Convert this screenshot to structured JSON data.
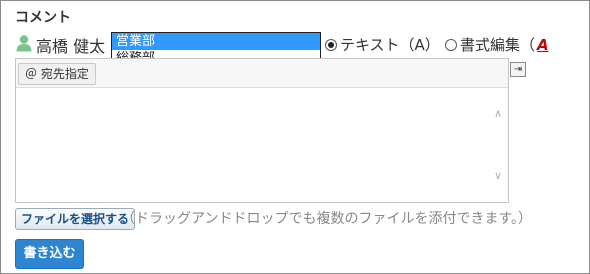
{
  "section_title": "コメント",
  "user": {
    "name": "高橋 健太",
    "icon": "user-icon"
  },
  "department_dropdown": {
    "options": [
      "営業部",
      "総務部"
    ],
    "selected": "営業部"
  },
  "format_options": [
    {
      "label": "テキスト（A）",
      "checked": true
    },
    {
      "label": "書式編集（",
      "checked": false,
      "icon_text": "A"
    }
  ],
  "editor": {
    "mention_button": "＠ 宛先指定",
    "scroll_up": "∧",
    "scroll_down": "∨",
    "expand_icon": "expand-icon"
  },
  "attachments": {
    "button_label": "ファイルを選択する",
    "hint": "（ドラッグアンドドロップでも複数のファイルを添付できます。）"
  },
  "submit_label": "書き込む",
  "colors": {
    "accent": "#2e86d2",
    "selection": "#3399ff",
    "user_icon": "#7cc48f",
    "format_icon": "#cc0000"
  }
}
